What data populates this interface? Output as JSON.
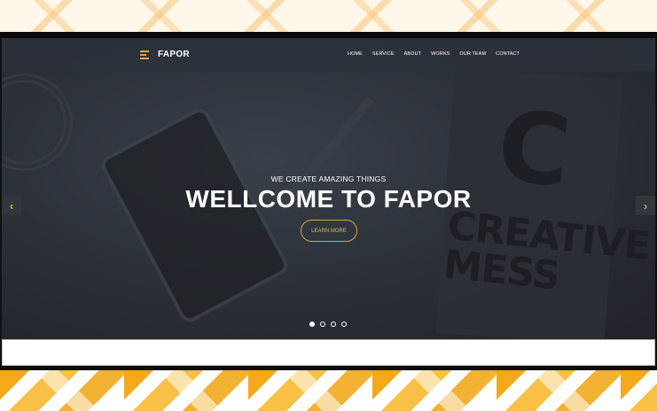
{
  "navbar": {
    "logo_text": "FAPOR",
    "items": [
      "HOME",
      "SERVICE",
      "ABOUT",
      "WORKS",
      "OUR TEAM",
      "CONTACT"
    ]
  },
  "hero": {
    "subtitle": "WE CREATE AMAZING THINGS",
    "title": "WELLCOME TO FAPOR",
    "cta_label": "LEARN MORE",
    "background_text": {
      "letter": "C",
      "lines": [
        "CREATIVE",
        "MESS"
      ]
    }
  },
  "slider": {
    "prev_arrow": "‹",
    "next_arrow": "›",
    "dot_count": 4,
    "active_index": 0
  },
  "colors": {
    "accent": "#e8a43a",
    "hero_bg": "#2a2f36",
    "nav_bg": "#2c323a"
  }
}
